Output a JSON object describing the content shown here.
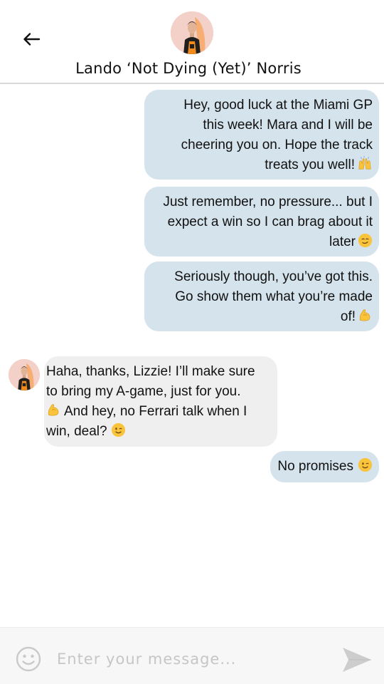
{
  "header": {
    "title": "Lando ‘Not Dying (Yet)’ Norris",
    "back_icon": "arrow-left-icon",
    "avatar": "contact-avatar"
  },
  "messages": [
    {
      "direction": "sent",
      "lines": [
        "Hey, good luck at the Miami GP",
        "this week! Mara and I will be",
        "cheering you on. Hope the track",
        "treats you well!"
      ],
      "emoji": "raising-hands"
    },
    {
      "direction": "sent",
      "lines": [
        "Just remember, no pressure... but I",
        "expect a win so I can brag about it",
        "later"
      ],
      "emoji": "smirking-face"
    },
    {
      "direction": "sent",
      "lines": [
        "Seriously though, you’ve got this.",
        "Go show them what you’re made",
        "of!"
      ],
      "emoji": "flexed-biceps"
    },
    {
      "direction": "received",
      "line1": "Haha, thanks, Lizzie! I’ll make sure",
      "line2": "to bring my A-game, just for you.",
      "emoji1": "flexed-biceps",
      "line3": "And hey, no Ferrari talk when I",
      "line4": "win, deal?",
      "emoji2": "winking-face"
    },
    {
      "direction": "sent",
      "lines": [
        "No promises"
      ],
      "emoji": "winking-face"
    }
  ],
  "composer": {
    "placeholder": "Enter your message...",
    "emoji_icon": "smiley-icon",
    "send_icon": "send-icon"
  },
  "colors": {
    "sent_bubble": "#d5e3ec",
    "received_bubble": "#efefef",
    "emoji_yellow": "#f9c33c",
    "icon_gray": "#c9c9c9"
  }
}
